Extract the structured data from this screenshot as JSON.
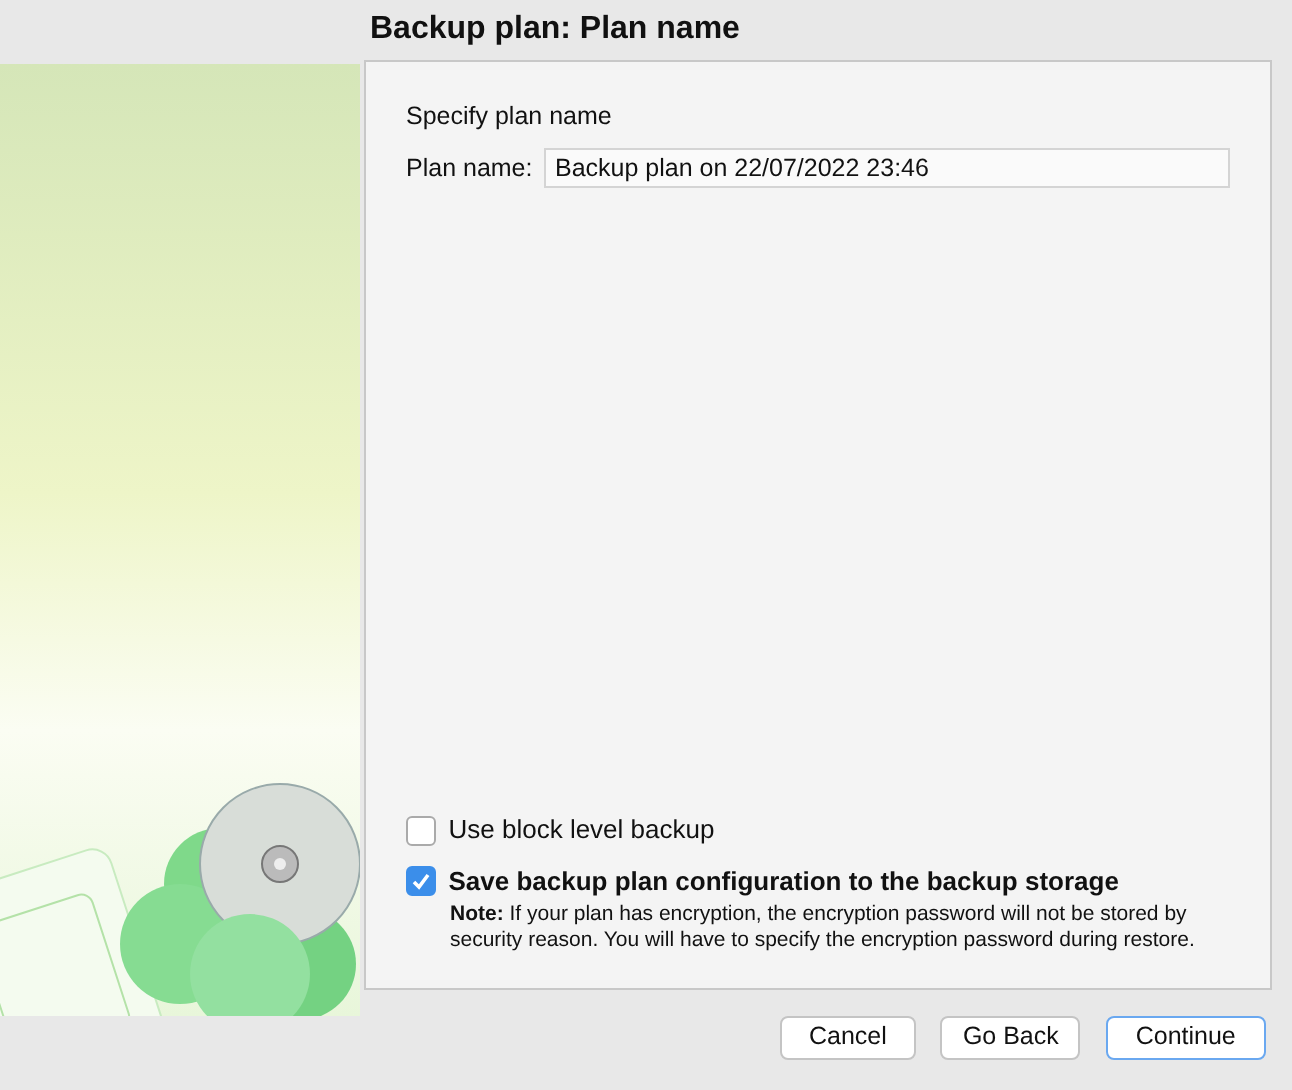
{
  "window": {
    "title": "Backup plan: Plan name"
  },
  "section_title": "Specify plan name",
  "plan_name": {
    "label": "Plan name:",
    "value": "Backup plan on 22/07/2022 23:46"
  },
  "options": [
    {
      "label": "Use block level backup",
      "checked": false,
      "bold": false
    },
    {
      "label": "Save backup plan configuration to the backup storage",
      "checked": true,
      "bold": true,
      "note": "**Note:** If your plan has encryption, the encryption password will not be stored by security reason. You will have to specify the encryption password during restore."
    }
  ],
  "buttons": [
    {
      "label": "Cancel",
      "default": false
    },
    {
      "label": "Go Back",
      "default": false
    },
    {
      "label": "Continue",
      "default": true
    }
  ]
}
